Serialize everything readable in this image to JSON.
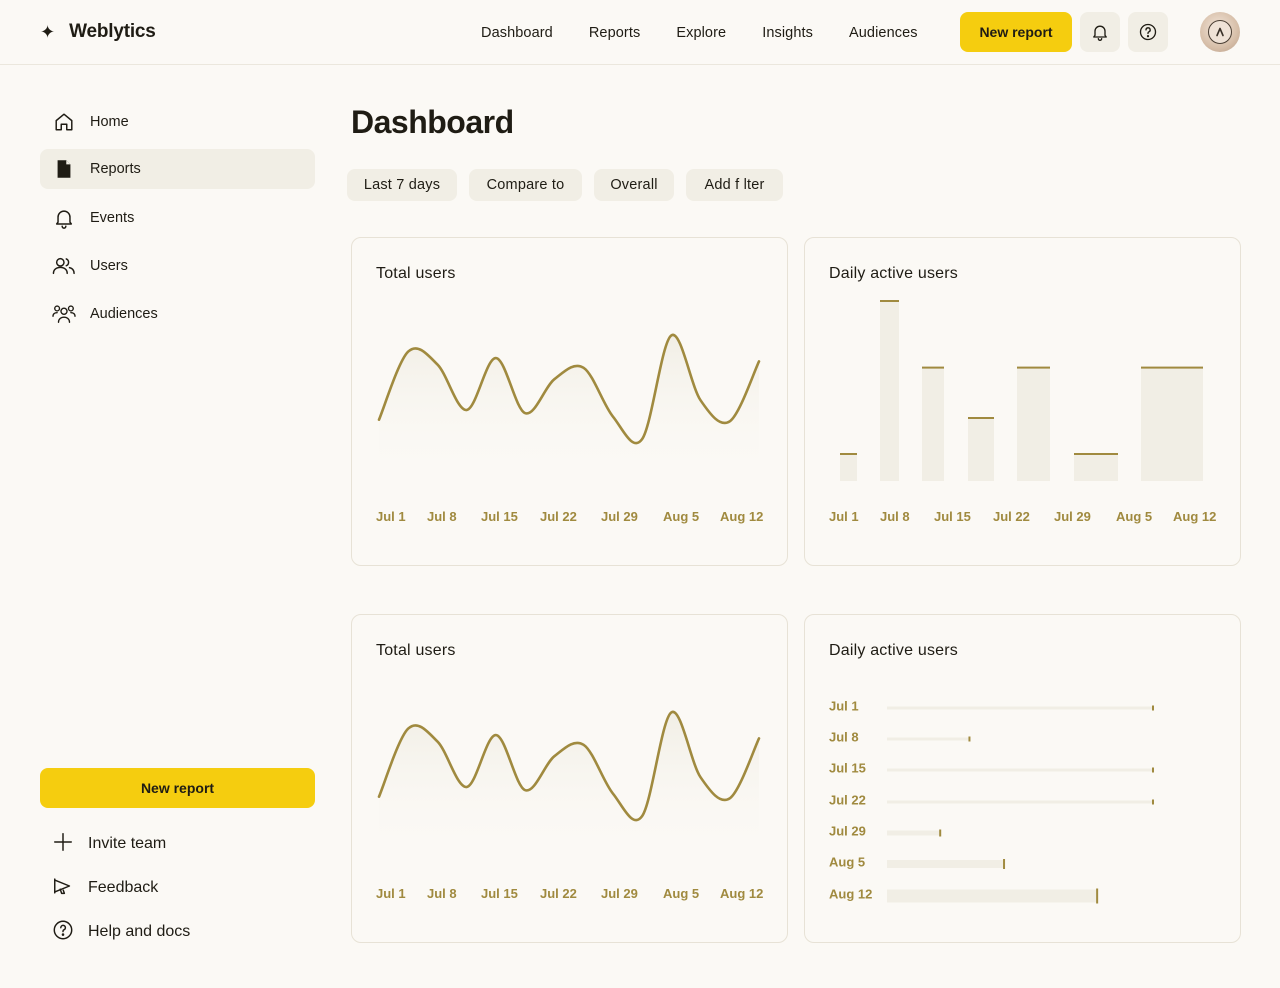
{
  "app": {
    "name": "Weblytics"
  },
  "topnav": {
    "items": [
      "Dashboard",
      "Reports",
      "Explore",
      "Insights",
      "Audiences"
    ],
    "new_report": "New report"
  },
  "sidebar": {
    "items": [
      {
        "label": "Home",
        "icon": "home-icon"
      },
      {
        "label": "Reports",
        "icon": "document-icon",
        "active": true
      },
      {
        "label": "Events",
        "icon": "bell-icon"
      },
      {
        "label": "Users",
        "icon": "users-icon"
      },
      {
        "label": "Audiences",
        "icon": "audiences-icon"
      }
    ],
    "new_report": "New report",
    "footer": [
      {
        "label": "Invite team",
        "icon": "plus-icon"
      },
      {
        "label": "Feedback",
        "icon": "megaphone-icon"
      },
      {
        "label": "Help and docs",
        "icon": "help-icon"
      }
    ]
  },
  "page": {
    "title": "Dashboard",
    "filters": [
      "Last 7 days",
      "Compare to",
      "Overall",
      "Add f lter"
    ]
  },
  "colors": {
    "accent": "#f5cd0f",
    "series": "#a08a3f",
    "bar_fill": "#f1eee5",
    "background": "#fbf9f5"
  },
  "chart_data": [
    {
      "type": "line",
      "title": "Total users",
      "x": [
        "Jul 1",
        "Jul 8",
        "Jul 15",
        "Jul 22",
        "Jul 29",
        "Aug 5",
        "Aug 12"
      ],
      "values": [
        36,
        78,
        70,
        42,
        74,
        40,
        61,
        68,
        38,
        24,
        88,
        48,
        35,
        72
      ],
      "ylim": [
        0,
        100
      ]
    },
    {
      "type": "bar",
      "title": "Daily active users",
      "categories": [
        "Jul 1",
        "Jul 8",
        "Jul 15",
        "Jul 22",
        "Jul 29",
        "Aug 5",
        "Aug 12"
      ],
      "values": [
        15,
        100,
        63,
        35,
        63,
        15,
        63
      ],
      "ylim": [
        0,
        100
      ]
    },
    {
      "type": "line",
      "title": "Total users",
      "x": [
        "Jul 1",
        "Jul 8",
        "Jul 15",
        "Jul 22",
        "Jul 29",
        "Aug 5",
        "Aug 12"
      ],
      "values": [
        36,
        78,
        70,
        42,
        74,
        40,
        61,
        68,
        38,
        24,
        88,
        48,
        35,
        72
      ],
      "ylim": [
        0,
        100
      ]
    },
    {
      "type": "bar",
      "orientation": "horizontal",
      "title": "Daily active users",
      "categories": [
        "Jul 1",
        "Jul 8",
        "Jul 15",
        "Jul 22",
        "Jul 29",
        "Aug 5",
        "Aug 12"
      ],
      "values": [
        100,
        31,
        100,
        100,
        20,
        44,
        79
      ],
      "xlim": [
        0,
        100
      ]
    }
  ]
}
